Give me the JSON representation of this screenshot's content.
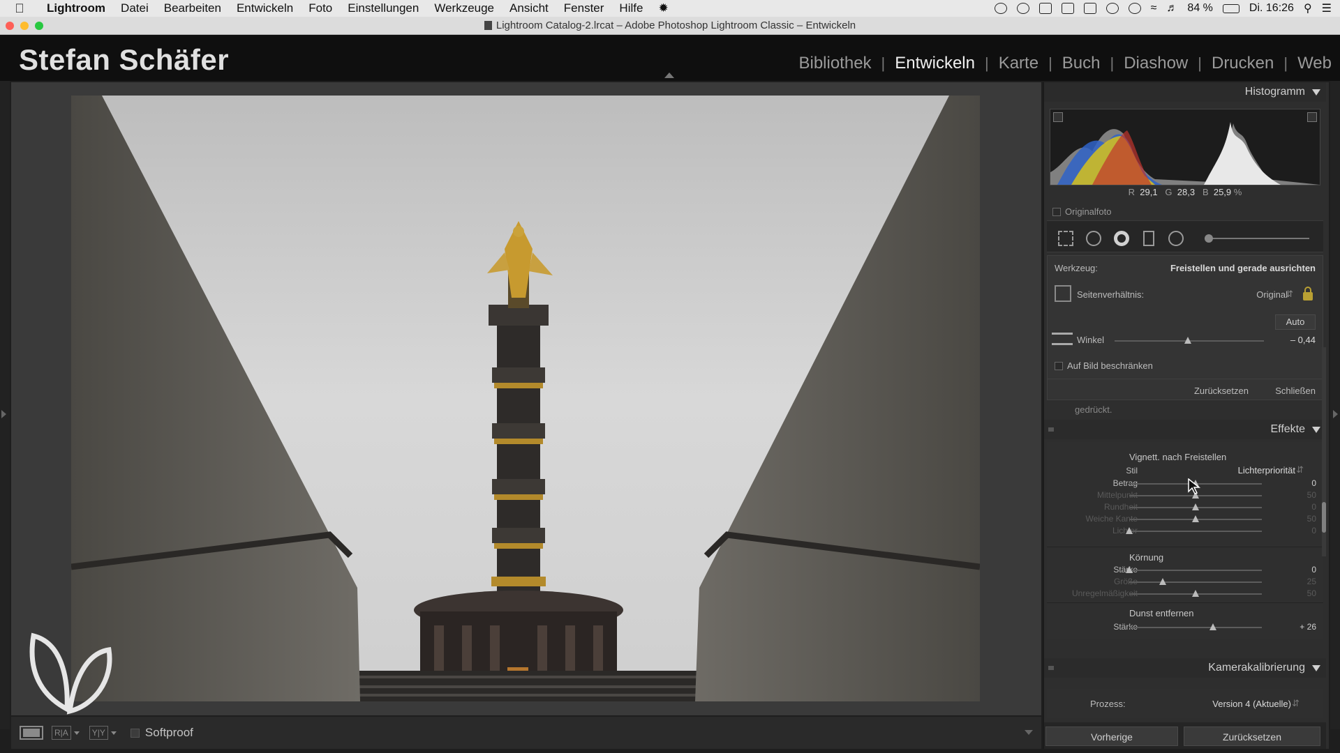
{
  "menubar": {
    "app_name": "Lightroom",
    "items": [
      "Datei",
      "Bearbeiten",
      "Entwickeln",
      "Foto",
      "Einstellungen",
      "Werkzeuge",
      "Ansicht",
      "Fenster",
      "Hilfe"
    ],
    "battery": "84 %",
    "clock": "Di. 16:26"
  },
  "window": {
    "title": "Lightroom Catalog-2.lrcat – Adobe Photoshop Lightroom Classic – Entwickeln"
  },
  "identity_plate": "Stefan Schäfer",
  "modules": [
    "Bibliothek",
    "Entwickeln",
    "Karte",
    "Buch",
    "Diashow",
    "Drucken",
    "Web"
  ],
  "active_module": "Entwickeln",
  "toolbar": {
    "view_ra": "R|A",
    "view_yy": "Y|Y",
    "softproof_label": "Softproof"
  },
  "histogram": {
    "title": "Histogramm",
    "r_label": "R",
    "r_value": "29,1",
    "g_label": "G",
    "g_value": "28,3",
    "b_label": "B",
    "b_value": "25,9",
    "percent": "%",
    "original_label": "Originalfoto"
  },
  "crop_tool": {
    "tool_label": "Werkzeug:",
    "tool_name": "Freistellen und gerade ausrichten",
    "aspect_label": "Seitenverhältnis:",
    "aspect_value": "Original",
    "auto_label": "Auto",
    "angle_label": "Winkel",
    "angle_value": "– 0,44",
    "angle_position": 0.49,
    "constrain_label": "Auf Bild beschränken",
    "reset_label": "Zurücksetzen",
    "close_label": "Schließen",
    "cut_text": "gedrückt."
  },
  "effects": {
    "title": "Effekte",
    "vignette": {
      "heading": "Vignett. nach Freistellen",
      "style_label": "Stil",
      "style_value": "Lichterpriorität",
      "sliders": [
        {
          "label": "Betrag",
          "value": "0",
          "pos": 0.5,
          "dim": false
        },
        {
          "label": "Mittelpunkt",
          "value": "50",
          "pos": 0.5,
          "dim": true
        },
        {
          "label": "Rundheit",
          "value": "0",
          "pos": 0.5,
          "dim": true
        },
        {
          "label": "Weiche Kante",
          "value": "50",
          "pos": 0.5,
          "dim": true
        },
        {
          "label": "Lichter",
          "value": "0",
          "pos": 0.0,
          "dim": true
        }
      ]
    },
    "grain": {
      "heading": "Körnung",
      "sliders": [
        {
          "label": "Stärke",
          "value": "0",
          "pos": 0.0,
          "dim": false
        },
        {
          "label": "Größe",
          "value": "25",
          "pos": 0.25,
          "dim": true
        },
        {
          "label": "Unregelmäßigkeit",
          "value": "50",
          "pos": 0.5,
          "dim": true
        }
      ]
    },
    "dehaze": {
      "heading": "Dunst entfernen",
      "label": "Stärke",
      "value": "+ 26",
      "pos": 0.63
    }
  },
  "calibration": {
    "title": "Kamerakalibrierung",
    "process_label": "Prozess:",
    "process_value": "Version 4 (Aktuelle)"
  },
  "bottom": {
    "previous_label": "Vorherige",
    "reset_label": "Zurücksetzen"
  },
  "colors": {
    "accent_lock": "#b9a033",
    "panel_bg": "#2e2e2e",
    "active_module": "#f0f0f0"
  }
}
